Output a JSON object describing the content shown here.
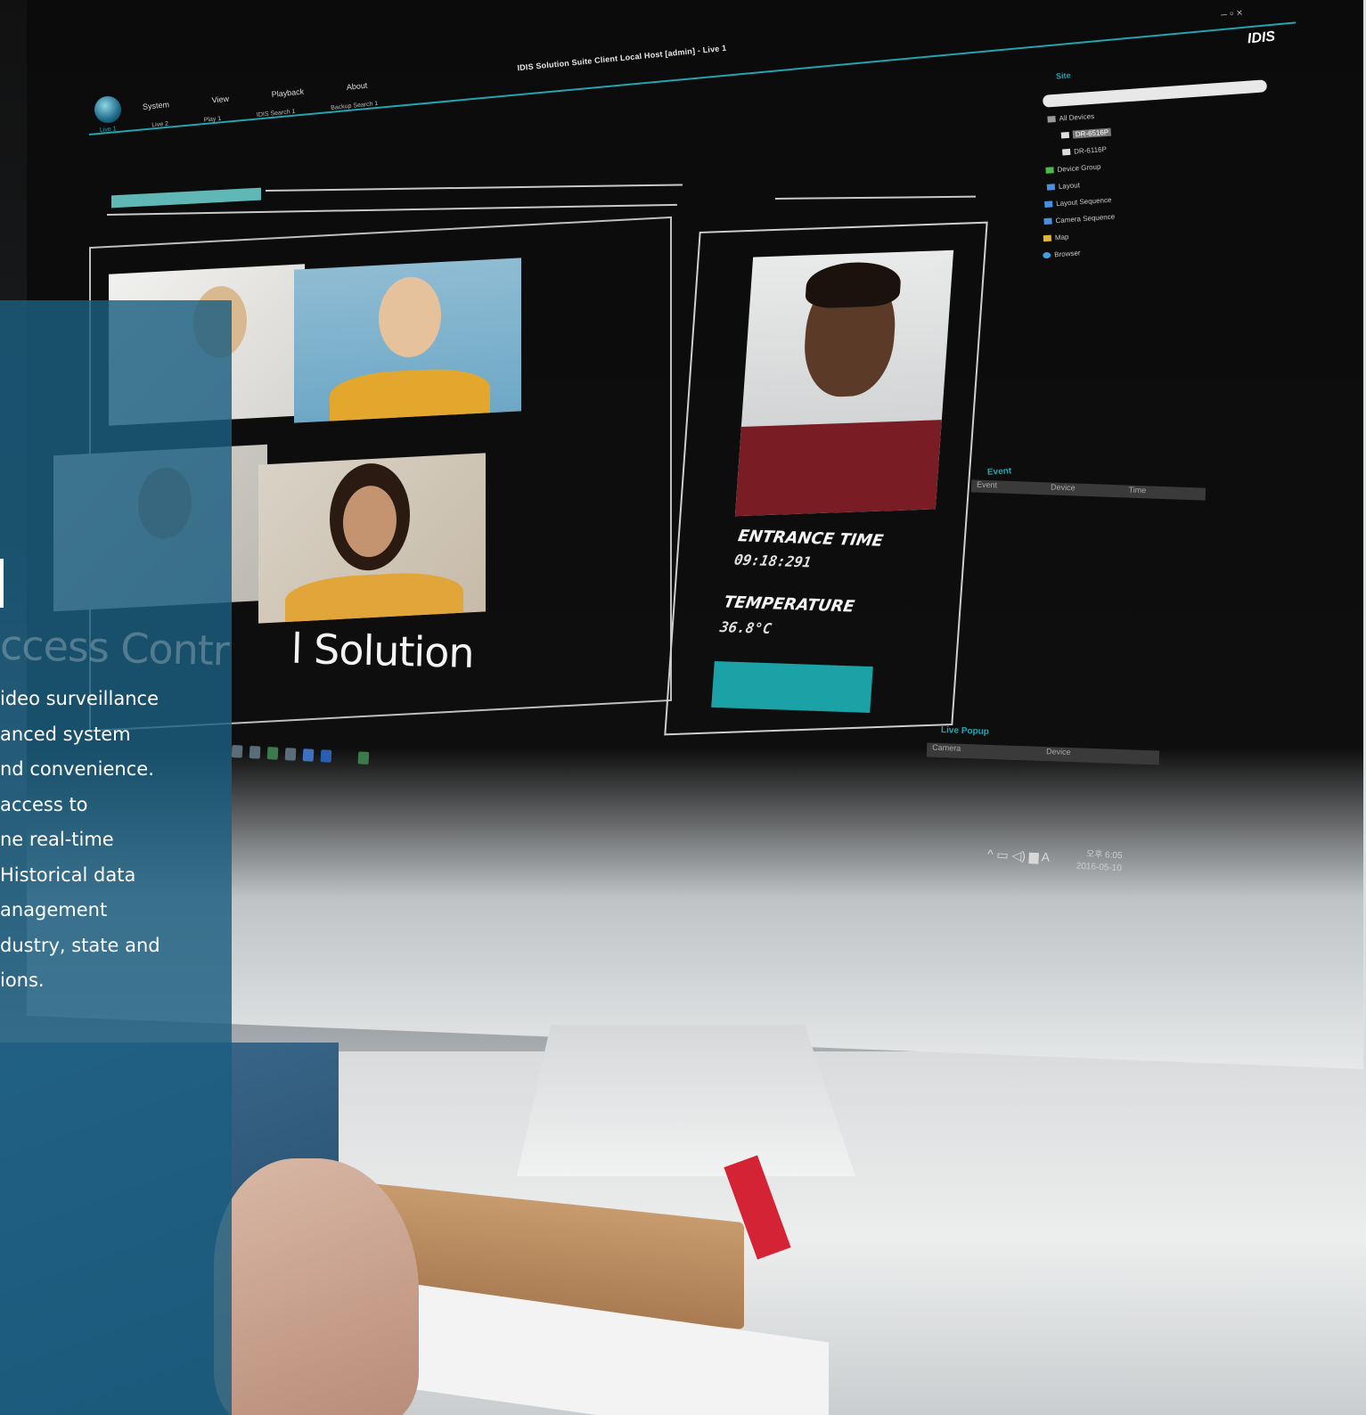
{
  "app": {
    "window_title": "IDIS Solution Suite Client Local Host [admin] - Live 1",
    "brand": "IDIS",
    "menu": [
      "System",
      "View",
      "Playback",
      "About"
    ],
    "tabs": [
      "Live 1",
      "Live 2",
      "Play 1",
      "IDIS Search 1",
      "Backup Search 1"
    ]
  },
  "video_wall": {
    "caption": "Access Control Solution",
    "caption_visible": "l Solution",
    "caption_ghost": "ccess Contr"
  },
  "entrance": {
    "time_label": "ENTRANCE TIME",
    "time_value": "09:18:291",
    "temp_label": "TEMPERATURE",
    "temp_value": "36.8°C"
  },
  "site_panel": {
    "title": "Site",
    "tree": [
      "All Devices",
      "DR-6516P",
      "DR-6116P",
      "Device Group",
      "Layout",
      "Layout Sequence",
      "Camera Sequence",
      "Map",
      "Browser"
    ]
  },
  "event_panel": {
    "title": "Event",
    "columns": [
      "Event",
      "Device",
      "Time"
    ]
  },
  "live_popup": {
    "title": "Live Popup",
    "columns": [
      "Camera",
      "Device"
    ]
  },
  "taskbar": {
    "time": "오후 6:05",
    "date": "2016-05-10",
    "ime": "A"
  },
  "overlay": {
    "lines": [
      "ideo surveillance",
      "anced system",
      "nd convenience.",
      "access to",
      "ne real-time",
      "Historical data",
      "anagement",
      "dustry, state and",
      "ions."
    ]
  },
  "colors": {
    "accent": "#23a5b0",
    "overlay": "#1b5e80",
    "teal_button": "#1aa2a6"
  }
}
